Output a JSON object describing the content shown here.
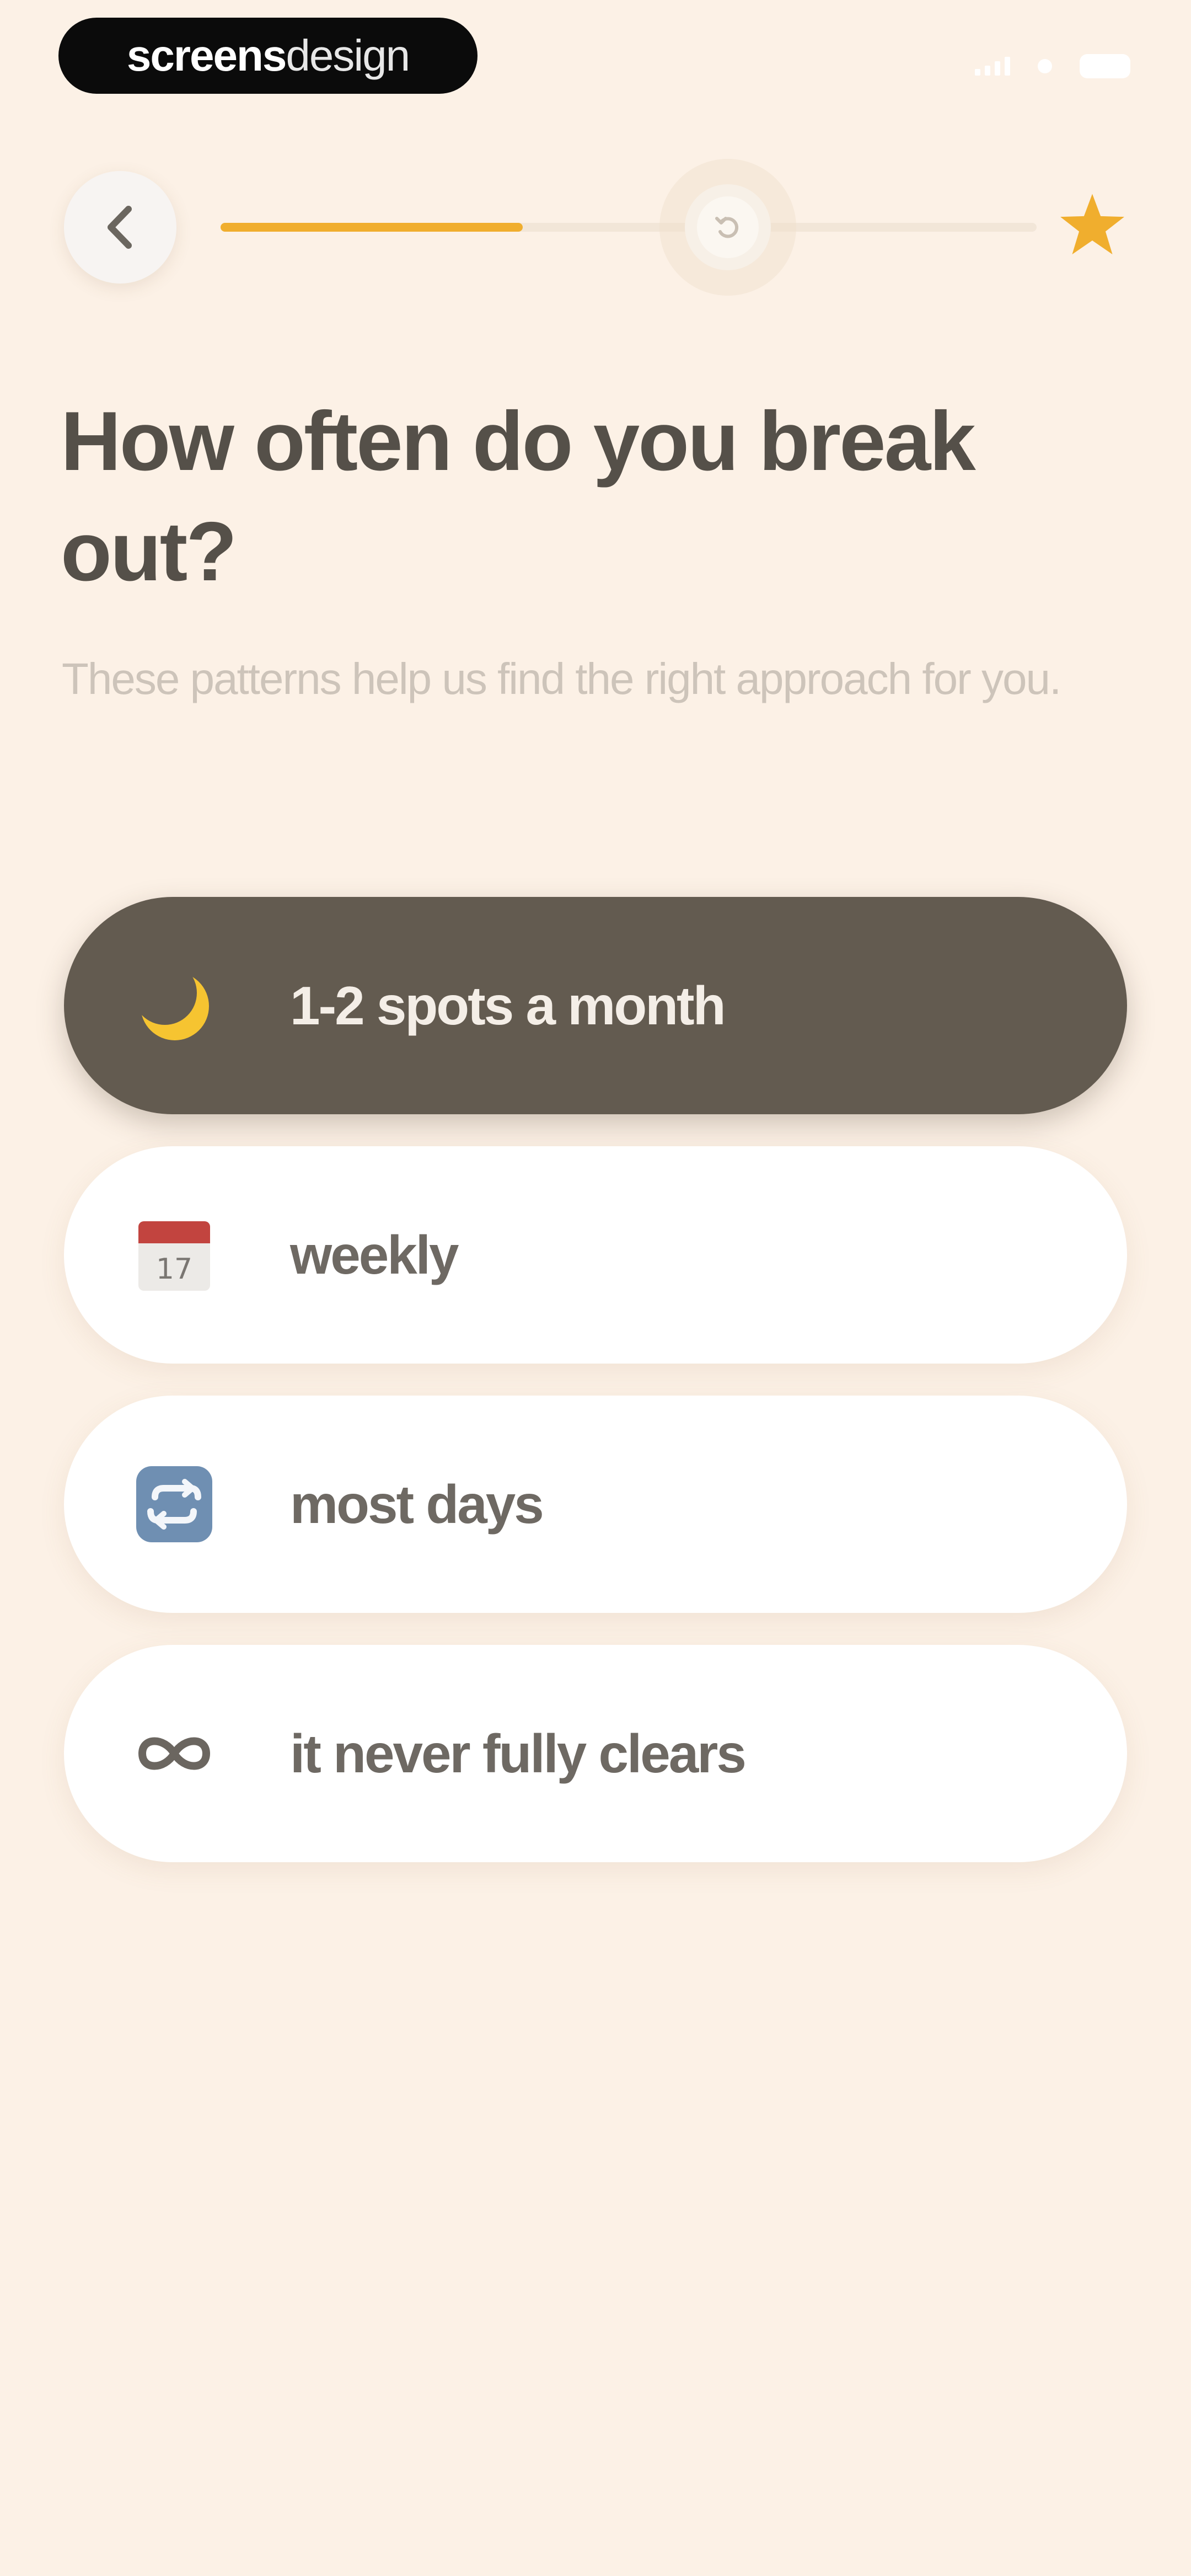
{
  "status_bar": {
    "watermark_bold": "screens",
    "watermark_light": "design"
  },
  "progress": {
    "fraction_complete": 0.37,
    "accent_color": "#f0ae2e"
  },
  "question": {
    "title": "How often do you break out?",
    "subtitle": "These patterns help us find the right approach for you."
  },
  "options": [
    {
      "label": "1-2 spots a month",
      "icon": "crescent-moon-icon",
      "selected": true
    },
    {
      "label": "weekly",
      "icon": "calendar-icon",
      "calendar_day": "17",
      "selected": false
    },
    {
      "label": "most days",
      "icon": "repeat-icon",
      "selected": false
    },
    {
      "label": "it never fully clears",
      "icon": "infinity-icon",
      "selected": false
    }
  ],
  "colors": {
    "background": "#fcf1e6",
    "selected_option": "#635b50",
    "title_text": "#555049"
  }
}
